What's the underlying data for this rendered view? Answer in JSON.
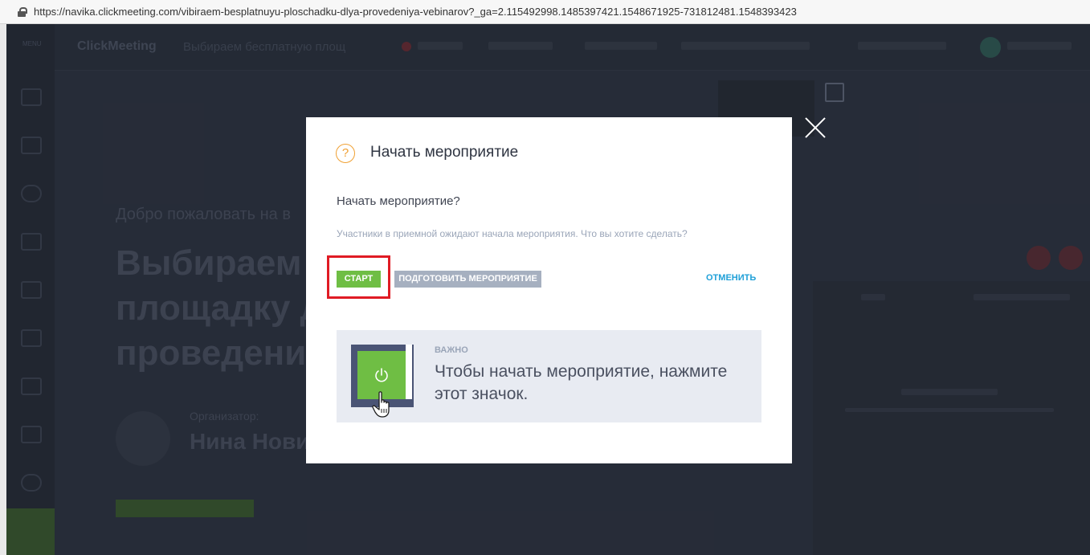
{
  "browser": {
    "url": "https://navika.clickmeeting.com/vibiraem-besplatnuyu-ploschadku-dlya-provedeniya-vebinarov?_ga=2.115492998.1485397421.1548671925-731812481.1548393423"
  },
  "background": {
    "sidebar_menu_label": "MENU",
    "brand": "ClickMeeting",
    "event_title": "Выбираем бесплатную площ",
    "welcome": "Добро пожаловать на в",
    "big_title": "Выбираем\nплощадку д\nпроведени",
    "organizer_label": "Организатор:",
    "organizer_name": "Нина Нови"
  },
  "modal": {
    "title": "Начать мероприятие",
    "question": "Начать мероприятие?",
    "description": "Участники в приемной ожидают начала мероприятия. Что вы хотите сделать?",
    "start_button": "СТАРТ",
    "prepare_button": "ПОДГОТОВИТЬ МЕРОПРИЯТИЕ",
    "cancel_button": "ОТМЕНИТЬ",
    "important_label": "ВАЖНО",
    "important_text": "Чтобы начать мероприятие, нажмите этот значок."
  },
  "colors": {
    "accent_green": "#6fbe44",
    "link_blue": "#1fa0d8",
    "highlight_red": "#e01b24",
    "question_icon": "#f0a032"
  },
  "icons": [
    "lock-icon",
    "question-icon",
    "close-icon",
    "power-icon",
    "hand-pointer-icon",
    "fullscreen-icon"
  ]
}
